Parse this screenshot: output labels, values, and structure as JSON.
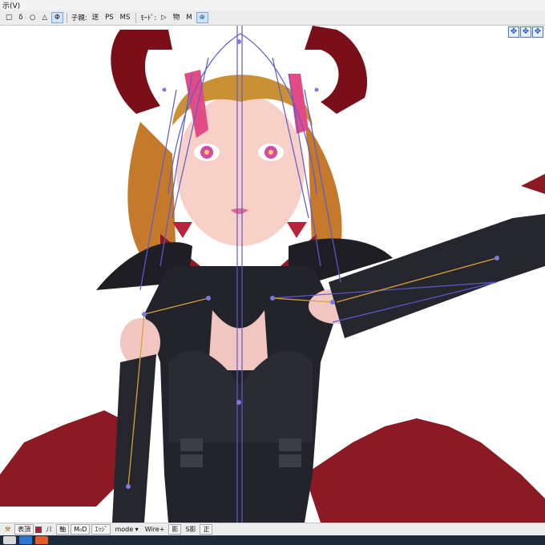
{
  "menubar": {
    "item": "示(V)"
  },
  "toolbar": {
    "shapes": [
      "□",
      "δ",
      "○",
      "△",
      "Φ"
    ],
    "kinematics_label": "子親:",
    "kinematics": [
      "送",
      "PS",
      "MS"
    ],
    "mode_label": "ﾓｰﾄﾞ:",
    "modes": [
      "▷",
      "物",
      "M"
    ],
    "target_icon": "⊕"
  },
  "view_nav": [
    "✥",
    "✥",
    "✥"
  ],
  "statusbar": {
    "items": [
      "表頂",
      "ﾉﾐ",
      "軸",
      "M₀D",
      "ｴｯｼﾞ",
      "mode ▾",
      "Wire+",
      "影",
      "S影",
      "正"
    ]
  },
  "colors": {
    "bone_blue": "#5d5ad0",
    "bone_orange": "#d9a03a",
    "wing_red": "#8b1a24",
    "outfit_black": "#1e1e24",
    "hair_orange": "#c47a2a"
  }
}
